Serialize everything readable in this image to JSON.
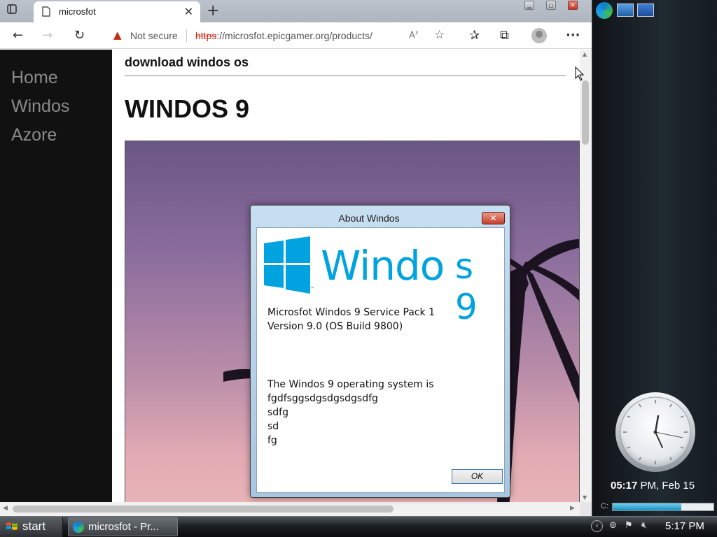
{
  "browser": {
    "tab": {
      "title": "microsfot"
    },
    "address": {
      "security_label": "Not secure",
      "url_scheme": "https",
      "url_rest": "://microsfot.epicgamer.org/products/"
    }
  },
  "page": {
    "nav": [
      "Home",
      "Windos",
      "Azore"
    ],
    "header": "download windos os",
    "title": "WINDOS 9"
  },
  "dialog": {
    "title": "About Windos",
    "logo_text_main": "Windo",
    "logo_text_end": "s 9",
    "lines": [
      "Microsfot Windos 9 Service Pack 1",
      "Version 9.0 (OS Build 9800)",
      "The Windos 9 operating system is",
      "fgdfsggsdgsdgsdgsdfg",
      "sdfg",
      "sd",
      "fg"
    ],
    "ok_label": "OK"
  },
  "sidebar": {
    "clock": {
      "time_bold": "05:17",
      "time_rest": " PM, Feb 15"
    },
    "drive": {
      "label": "C:",
      "fill_fraction": 0.68
    }
  },
  "taskbar": {
    "start_label": "start",
    "task_label": "microsfot - Pr...",
    "tray_time": "5:17 PM"
  },
  "icons": {
    "back": "arrow-left-icon",
    "forward": "arrow-right-icon",
    "reload": "reload-icon",
    "warning": "warning-icon",
    "favorites": "star-icon",
    "collections": "collections-icon",
    "profile": "profile-icon",
    "menu": "ellipsis-icon"
  },
  "colors": {
    "warning": "#c42b1c",
    "logo": "#00a3e0",
    "sidenav_bg": "#111111",
    "taskbar_bg": "#1c2024"
  }
}
